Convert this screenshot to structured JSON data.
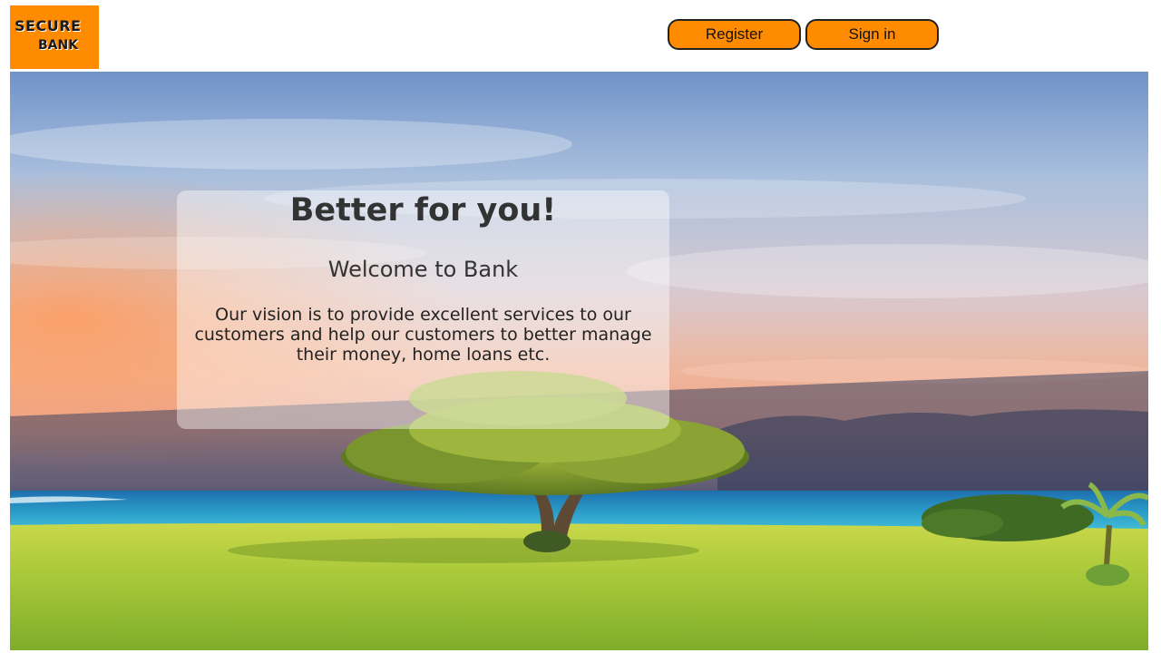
{
  "header": {
    "logo_line1": "SECURE",
    "logo_line2": "BANK",
    "register_label": "Register",
    "signin_label": "Sign in"
  },
  "hero": {
    "heading": "Better for you!",
    "subheading": "Welcome to Bank",
    "description": "Our vision is to provide excellent services to our customers and help our customers to better manage their money, home loans etc."
  },
  "colors": {
    "accent": "#ff8c00",
    "button_border": "#222222",
    "text": "#333333"
  },
  "icons": {
    "logo": "secure-bank-logo"
  }
}
